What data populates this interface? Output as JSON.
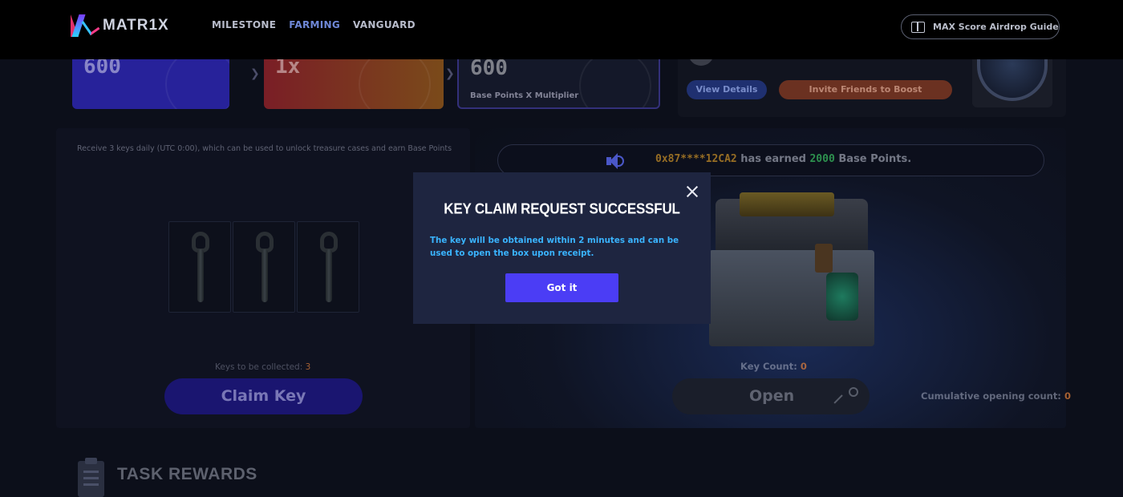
{
  "header": {
    "logo_text": "MATR1X",
    "nav": [
      {
        "label": "MILESTONE",
        "active": false
      },
      {
        "label": "FARMING",
        "active": true
      },
      {
        "label": "VANGUARD",
        "active": false
      }
    ],
    "guide_label": "MAX Score Airdrop Guide"
  },
  "stats": {
    "base_points": "600",
    "multiplier": "1x",
    "total_points": "600",
    "total_label": "Base Points X Multiplier",
    "view_details": "View Details",
    "invite_friends": "Invite Friends to Boost"
  },
  "keys_panel": {
    "description": "Receive 3 keys daily (UTC 0:00), which can be used to unlock treasure cases and earn Base Points",
    "keys_to_collect_label": "Keys to be collected:",
    "keys_to_collect_value": "3",
    "claim_label": "Claim Key"
  },
  "chest_panel": {
    "ticker_address": "0x87****12CA2",
    "ticker_mid": "has earned",
    "ticker_points": "2000",
    "ticker_suffix": "Base Points.",
    "key_count_label": "Key Count:",
    "key_count_value": "0",
    "open_label": "Open",
    "cumulative_label": "Cumulative opening count:",
    "cumulative_value": "0"
  },
  "tasks": {
    "title": "TASK REWARDS"
  },
  "modal": {
    "title": "KEY CLAIM REQUEST SUCCESSFUL",
    "message": "The key will be obtained within 2 minutes and can be used to open the box upon receipt.",
    "button_label": "Got it"
  },
  "colors": {
    "modal_bg": "#1e2540",
    "modal_text": "#3ab4ff",
    "button_bg": "#4b3df5",
    "accent_orange": "#e6823c"
  },
  "icons": [
    "guide-book-icon",
    "speaker-icon",
    "close-icon",
    "key-icon",
    "clipboard-icon"
  ]
}
